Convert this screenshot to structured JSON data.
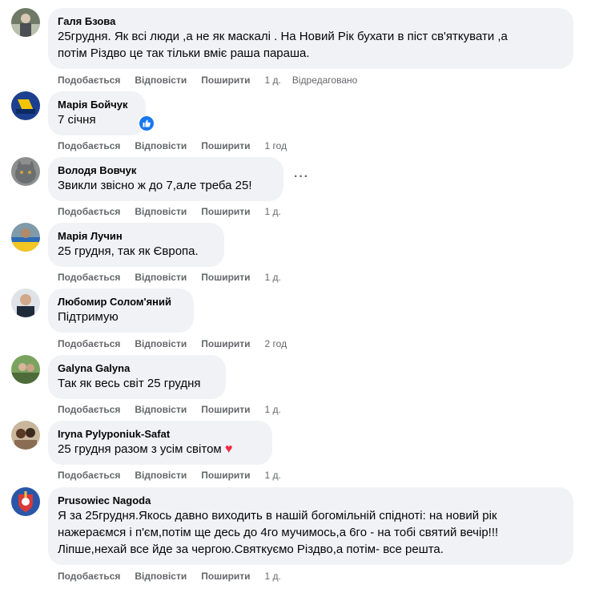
{
  "actions": {
    "like": "Подобається",
    "reply": "Відповісти",
    "share": "Поширити",
    "edited": "Відредаговано"
  },
  "comments": [
    {
      "author": "Галя Бзова",
      "lines": [
        "25грудня. Як всі люди ,а не як маскалі . На Новий Рік бухати в піст св'яткувати ,а",
        "потім Різдво це так тільки вміє раша параша."
      ],
      "time": "1 д."
    },
    {
      "author": "Марія Бойчук",
      "lines": [
        "7 січня"
      ],
      "time": "1 год"
    },
    {
      "author": "Володя Вовчук",
      "lines": [
        "Звикли звісно ж до 7,але треба 25!"
      ],
      "time": "1 д."
    },
    {
      "author": "Марія Лучин",
      "lines": [
        "25 грудня, так як Європа."
      ],
      "time": "1 д."
    },
    {
      "author": "Любомир Солом'яний",
      "lines": [
        "Підтримую"
      ],
      "time": "2 год"
    },
    {
      "author": "Galyna Galyna",
      "lines": [
        "Так як весь світ 25 грудня"
      ],
      "time": "1 д."
    },
    {
      "author": "Iryna Pylyponiuk-Safat",
      "lines": [
        "25 грудня разом з усім світом"
      ],
      "time": "1 д."
    },
    {
      "author": "Prusowiec Nagoda",
      "lines": [
        "Я за 25грудня.Якось давно виходить в нашій богомільній спідноті: на новий рік",
        "нажераємся і п'єм,потім ще десь до 4го мучимось,а 6го - на тобі святий вечір!!!",
        "Ліпше,нехай все йде за чергою.Святкуємо Різдво,а потім- все решта."
      ],
      "time": "1 д."
    }
  ],
  "colors": {
    "bubble": "#f0f2f5",
    "meta": "#65676b",
    "like_blue": "#1877f2",
    "heart": "#f02849"
  }
}
